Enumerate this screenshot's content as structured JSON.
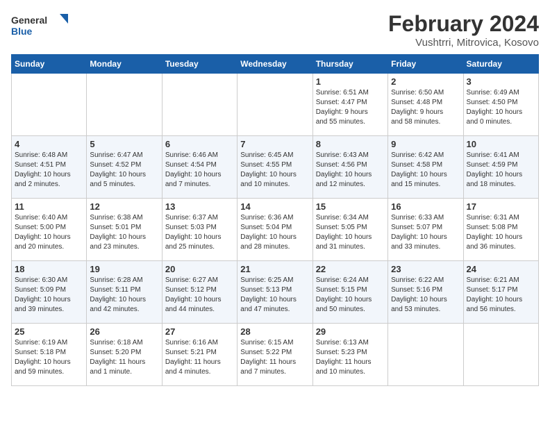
{
  "app": {
    "logo_line1": "General",
    "logo_line2": "Blue"
  },
  "header": {
    "title": "February 2024",
    "subtitle": "Vushtrri, Mitrovica, Kosovo"
  },
  "days_of_week": [
    "Sunday",
    "Monday",
    "Tuesday",
    "Wednesday",
    "Thursday",
    "Friday",
    "Saturday"
  ],
  "weeks": [
    [
      {
        "day": "",
        "info": ""
      },
      {
        "day": "",
        "info": ""
      },
      {
        "day": "",
        "info": ""
      },
      {
        "day": "",
        "info": ""
      },
      {
        "day": "1",
        "info": "Sunrise: 6:51 AM\nSunset: 4:47 PM\nDaylight: 9 hours\nand 55 minutes."
      },
      {
        "day": "2",
        "info": "Sunrise: 6:50 AM\nSunset: 4:48 PM\nDaylight: 9 hours\nand 58 minutes."
      },
      {
        "day": "3",
        "info": "Sunrise: 6:49 AM\nSunset: 4:50 PM\nDaylight: 10 hours\nand 0 minutes."
      }
    ],
    [
      {
        "day": "4",
        "info": "Sunrise: 6:48 AM\nSunset: 4:51 PM\nDaylight: 10 hours\nand 2 minutes."
      },
      {
        "day": "5",
        "info": "Sunrise: 6:47 AM\nSunset: 4:52 PM\nDaylight: 10 hours\nand 5 minutes."
      },
      {
        "day": "6",
        "info": "Sunrise: 6:46 AM\nSunset: 4:54 PM\nDaylight: 10 hours\nand 7 minutes."
      },
      {
        "day": "7",
        "info": "Sunrise: 6:45 AM\nSunset: 4:55 PM\nDaylight: 10 hours\nand 10 minutes."
      },
      {
        "day": "8",
        "info": "Sunrise: 6:43 AM\nSunset: 4:56 PM\nDaylight: 10 hours\nand 12 minutes."
      },
      {
        "day": "9",
        "info": "Sunrise: 6:42 AM\nSunset: 4:58 PM\nDaylight: 10 hours\nand 15 minutes."
      },
      {
        "day": "10",
        "info": "Sunrise: 6:41 AM\nSunset: 4:59 PM\nDaylight: 10 hours\nand 18 minutes."
      }
    ],
    [
      {
        "day": "11",
        "info": "Sunrise: 6:40 AM\nSunset: 5:00 PM\nDaylight: 10 hours\nand 20 minutes."
      },
      {
        "day": "12",
        "info": "Sunrise: 6:38 AM\nSunset: 5:01 PM\nDaylight: 10 hours\nand 23 minutes."
      },
      {
        "day": "13",
        "info": "Sunrise: 6:37 AM\nSunset: 5:03 PM\nDaylight: 10 hours\nand 25 minutes."
      },
      {
        "day": "14",
        "info": "Sunrise: 6:36 AM\nSunset: 5:04 PM\nDaylight: 10 hours\nand 28 minutes."
      },
      {
        "day": "15",
        "info": "Sunrise: 6:34 AM\nSunset: 5:05 PM\nDaylight: 10 hours\nand 31 minutes."
      },
      {
        "day": "16",
        "info": "Sunrise: 6:33 AM\nSunset: 5:07 PM\nDaylight: 10 hours\nand 33 minutes."
      },
      {
        "day": "17",
        "info": "Sunrise: 6:31 AM\nSunset: 5:08 PM\nDaylight: 10 hours\nand 36 minutes."
      }
    ],
    [
      {
        "day": "18",
        "info": "Sunrise: 6:30 AM\nSunset: 5:09 PM\nDaylight: 10 hours\nand 39 minutes."
      },
      {
        "day": "19",
        "info": "Sunrise: 6:28 AM\nSunset: 5:11 PM\nDaylight: 10 hours\nand 42 minutes."
      },
      {
        "day": "20",
        "info": "Sunrise: 6:27 AM\nSunset: 5:12 PM\nDaylight: 10 hours\nand 44 minutes."
      },
      {
        "day": "21",
        "info": "Sunrise: 6:25 AM\nSunset: 5:13 PM\nDaylight: 10 hours\nand 47 minutes."
      },
      {
        "day": "22",
        "info": "Sunrise: 6:24 AM\nSunset: 5:15 PM\nDaylight: 10 hours\nand 50 minutes."
      },
      {
        "day": "23",
        "info": "Sunrise: 6:22 AM\nSunset: 5:16 PM\nDaylight: 10 hours\nand 53 minutes."
      },
      {
        "day": "24",
        "info": "Sunrise: 6:21 AM\nSunset: 5:17 PM\nDaylight: 10 hours\nand 56 minutes."
      }
    ],
    [
      {
        "day": "25",
        "info": "Sunrise: 6:19 AM\nSunset: 5:18 PM\nDaylight: 10 hours\nand 59 minutes."
      },
      {
        "day": "26",
        "info": "Sunrise: 6:18 AM\nSunset: 5:20 PM\nDaylight: 11 hours\nand 1 minute."
      },
      {
        "day": "27",
        "info": "Sunrise: 6:16 AM\nSunset: 5:21 PM\nDaylight: 11 hours\nand 4 minutes."
      },
      {
        "day": "28",
        "info": "Sunrise: 6:15 AM\nSunset: 5:22 PM\nDaylight: 11 hours\nand 7 minutes."
      },
      {
        "day": "29",
        "info": "Sunrise: 6:13 AM\nSunset: 5:23 PM\nDaylight: 11 hours\nand 10 minutes."
      },
      {
        "day": "",
        "info": ""
      },
      {
        "day": "",
        "info": ""
      }
    ]
  ]
}
